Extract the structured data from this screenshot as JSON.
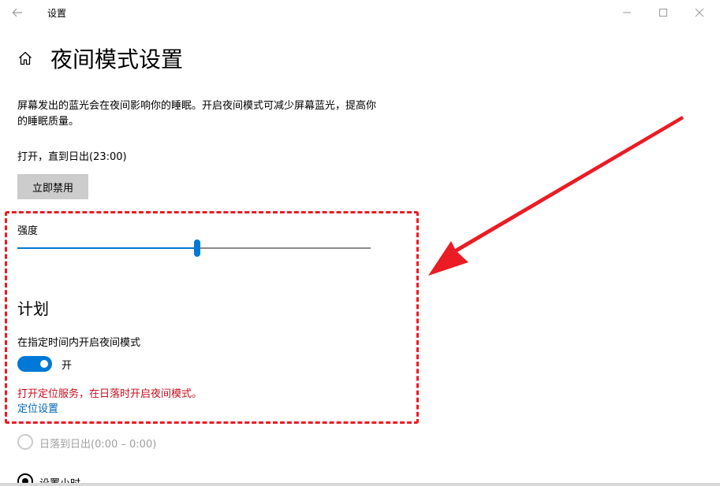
{
  "window": {
    "app_title": "设置",
    "back_icon": "back-arrow-icon",
    "minimize_icon": "minimize-icon",
    "maximize_icon": "maximize-icon",
    "close_icon": "close-icon"
  },
  "page": {
    "home_icon": "home-icon",
    "title": "夜间模式设置",
    "description": "屏幕发出的蓝光会在夜间影响你的睡眠。开启夜间模式可减少屏幕蓝光，提高你的睡眠质量。",
    "status": "打开，直到日出(23:00)",
    "disable_button_label": "立即禁用"
  },
  "strength": {
    "label": "强度",
    "value_percent": 51,
    "fill_color": "#0078d7",
    "track_color": "#8a8a8a"
  },
  "schedule": {
    "heading": "计划",
    "toggle_label": "在指定时间内开启夜间模式",
    "toggle_on": true,
    "toggle_state_label": "开",
    "warning": "打开定位服务，在日落时开启夜间模式。",
    "location_link": "定位设置",
    "options": [
      {
        "label": "日落到日出(0:00 – 0:00)",
        "selected": false,
        "disabled": true
      },
      {
        "label": "设置小时",
        "selected": true,
        "disabled": false
      }
    ]
  },
  "colors": {
    "accent": "#0078d7",
    "warning": "#c50f1f",
    "link": "#0067b8",
    "annotation": "#ea1c24"
  }
}
